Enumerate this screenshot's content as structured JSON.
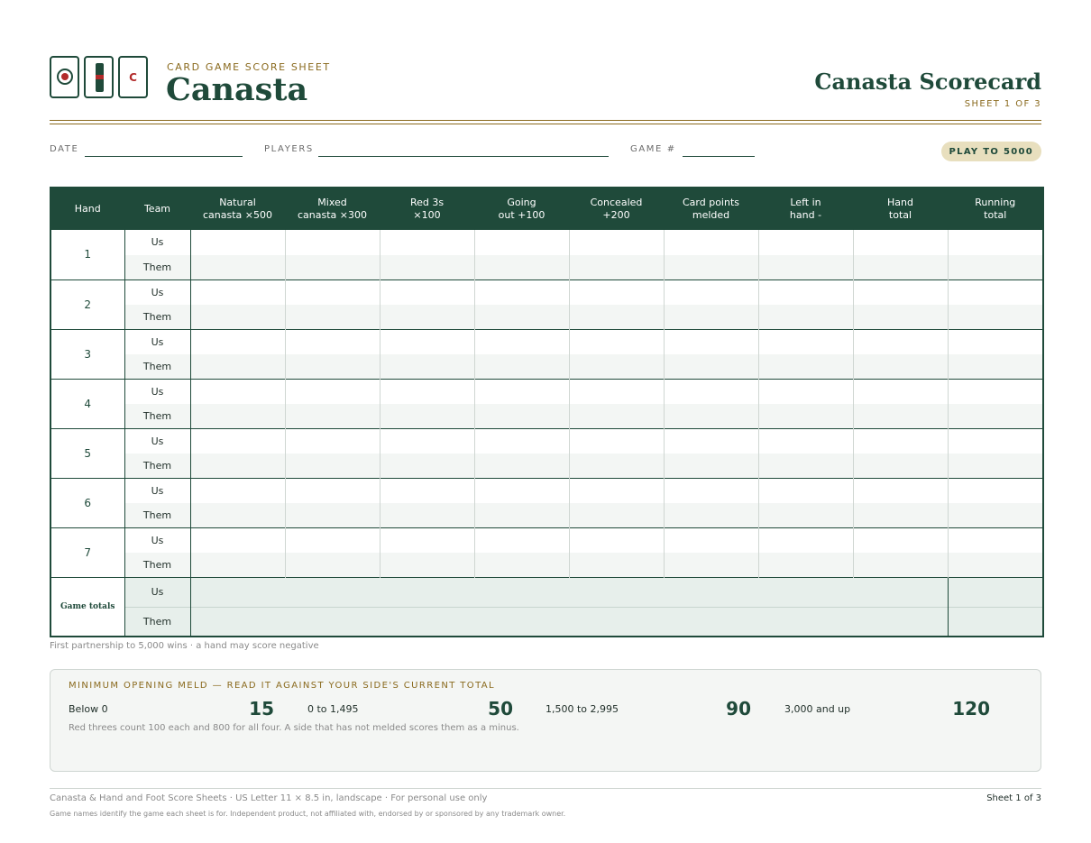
{
  "header": {
    "eyebrow": "CARD GAME SCORE SHEET",
    "title": "Canasta",
    "right_title": "Canasta Scorecard",
    "sheet_of": "SHEET 1 OF 3",
    "logo_letter": "C"
  },
  "info": {
    "date_label": "DATE",
    "players_label": "PLAYERS",
    "game_label": "GAME #",
    "pill": "PLAY TO 5000"
  },
  "table": {
    "columns": [
      {
        "line1": "Hand",
        "line2": ""
      },
      {
        "line1": "Team",
        "line2": ""
      },
      {
        "line1": "Natural",
        "line2": "canasta ×500"
      },
      {
        "line1": "Mixed",
        "line2": "canasta ×300"
      },
      {
        "line1": "Red 3s",
        "line2": "×100"
      },
      {
        "line1": "Going",
        "line2": "out +100"
      },
      {
        "line1": "Concealed",
        "line2": "+200"
      },
      {
        "line1": "Card points",
        "line2": "melded"
      },
      {
        "line1": "Left in",
        "line2": "hand  -"
      },
      {
        "line1": "Hand",
        "line2": "total"
      },
      {
        "line1": "Running",
        "line2": "total"
      }
    ],
    "hands": [
      "1",
      "2",
      "3",
      "4",
      "5",
      "6",
      "7"
    ],
    "team_us": "Us",
    "team_them": "Them",
    "totals_label": "Game totals"
  },
  "note": "First partnership to 5,000 wins  ·  a hand may score negative",
  "meld": {
    "title": "MINIMUM OPENING MELD — READ IT AGAINST YOUR SIDE'S CURRENT TOTAL",
    "tiers": [
      {
        "range": "Below 0",
        "value": "15"
      },
      {
        "range": "0 to 1,495",
        "value": "50"
      },
      {
        "range": "1,500 to 2,995",
        "value": "90"
      },
      {
        "range": "3,000 and up",
        "value": "120"
      }
    ],
    "footnote": "Red threes count 100 each and 800 for all four. A side that has not melded scores them as a minus."
  },
  "footer": {
    "left": "Canasta & Hand and Foot Score Sheets   ·   US Letter 11 × 8.5 in, landscape   ·   For personal use only",
    "right": "Sheet 1 of 3",
    "small": "Game names identify the game each sheet is for. Independent product, not affiliated with, endorsed by or sponsored by any trademark owner."
  },
  "colors": {
    "brand": "#1f4a3a",
    "accent": "#8a6a1e",
    "suit_red": "#b22a2a"
  }
}
